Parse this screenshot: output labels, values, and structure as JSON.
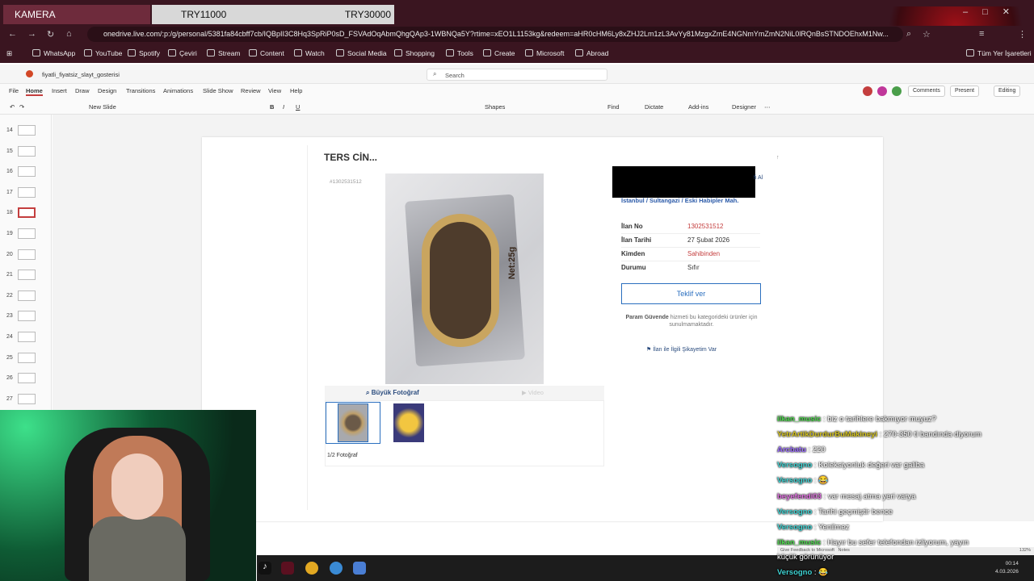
{
  "tabs": {
    "kamera": "KAMERA",
    "try1": "TRY11000",
    "try2": "TRY30000"
  },
  "address": {
    "url": "onedrive.live.com/:p:/g/personal/5381fa84cbff7cb/IQBpII3C8Hq3SpRiP0sD_FSVAdOqAbmQhgQAp3-1WBNQa5Y?rtime=xEO1L1153kg&redeem=aHR0cHM6Ly8xZHJ2Lm1zL3AvYy81MzgxZmE4NGNmYmZmN2NiL0lRQnBsSTNDOEhxM1Nw..."
  },
  "bookmarks": [
    "WhatsApp",
    "YouTube",
    "Spotify",
    "Çeviri",
    "Stream",
    "Content",
    "Watch",
    "Social Media",
    "Shopping",
    "Tools",
    "Create",
    "Microsoft",
    "Abroad",
    "Tüm Yer İşaretleri"
  ],
  "app": {
    "file_name": "fiyatli_fiyatsiz_slayt_gosterisi",
    "search_placeholder": "Search"
  },
  "menu": [
    "File",
    "Home",
    "Insert",
    "Draw",
    "Design",
    "Transitions",
    "Animations",
    "Slide Show",
    "Review",
    "View",
    "Help"
  ],
  "ribbon": {
    "new_slide": "New Slide",
    "shapes": "Shapes",
    "find": "Find",
    "dictate": "Dictate",
    "addins": "Add-ins",
    "designer": "Designer",
    "comments": "Comments",
    "present": "Present",
    "editing": "Editing"
  },
  "slides": [
    "14",
    "15",
    "16",
    "17",
    "18",
    "19",
    "20",
    "21",
    "22",
    "23",
    "24",
    "25",
    "26",
    "27"
  ],
  "listing": {
    "title": "TERS CİN...",
    "code": "#1302531512",
    "location": "İstanbul / Sultangazi / Eski Habipler Mah.",
    "redact_tail": "fi Al",
    "fields": [
      {
        "label": "İlan No",
        "value": "1302531512"
      },
      {
        "label": "İlan Tarihi",
        "value": "27 Şubat 2026"
      },
      {
        "label": "Kimden",
        "value": "Sahibinden"
      },
      {
        "label": "Durumu",
        "value": "Sıfır"
      }
    ],
    "offer_button": "Teklif ver",
    "guvende_bold": "Param Güvende",
    "guvende_rest": " hizmeti bu kategorideki ürünler için sunulmamaktadır.",
    "complain": "İlan ile İlgili Şikayetim Var",
    "big_photo": "Büyük Fotoğraf",
    "video": "Video",
    "photo_count": "1/2 Fotoğraf",
    "product_label": "Net:25g"
  },
  "chat": [
    {
      "user": "ilkan_music",
      "text": " : biz o tarihlere bakmıyor muyuz?",
      "color": "#4bd94b"
    },
    {
      "user": "YetrArtikDurdurBuMakineyi",
      "text": " : 270-350 tl bandında diyorum",
      "color": "#d4c21c"
    },
    {
      "user": "Arcbatu",
      "text": " : 220",
      "color": "#9b6cff"
    },
    {
      "user": "Versogno",
      "text": " : Koleksiyonluk değeri var galiba",
      "color": "#3fd3d3"
    },
    {
      "user": "Versogno",
      "text": " : 😂",
      "color": "#3fd3d3"
    },
    {
      "user": "beyefendi03",
      "text": " : var mesaj atma yeri varya",
      "color": "#e06fe0"
    },
    {
      "user": "Versogno",
      "text": " : Tarihi geçmiştir bence",
      "color": "#3fd3d3"
    },
    {
      "user": "Versogno",
      "text": " : Yenilmez",
      "color": "#3fd3d3"
    },
    {
      "user": "ilkan_music",
      "text": " : Hayır bu sefer telefondan izliyorum, yayın",
      "color": "#4bd94b"
    },
    {
      "user": "",
      "text": "küçük görünüyor",
      "color": "#ffffff"
    },
    {
      "user": "Versogno",
      "text": " : 😂",
      "color": "#3fd3d3"
    }
  ],
  "status": {
    "feedback": "Give Feedback to Microsoft",
    "notes": "Notes",
    "zoom": "132%"
  },
  "clock": {
    "time": "00:14",
    "date": "4.03.2026"
  }
}
